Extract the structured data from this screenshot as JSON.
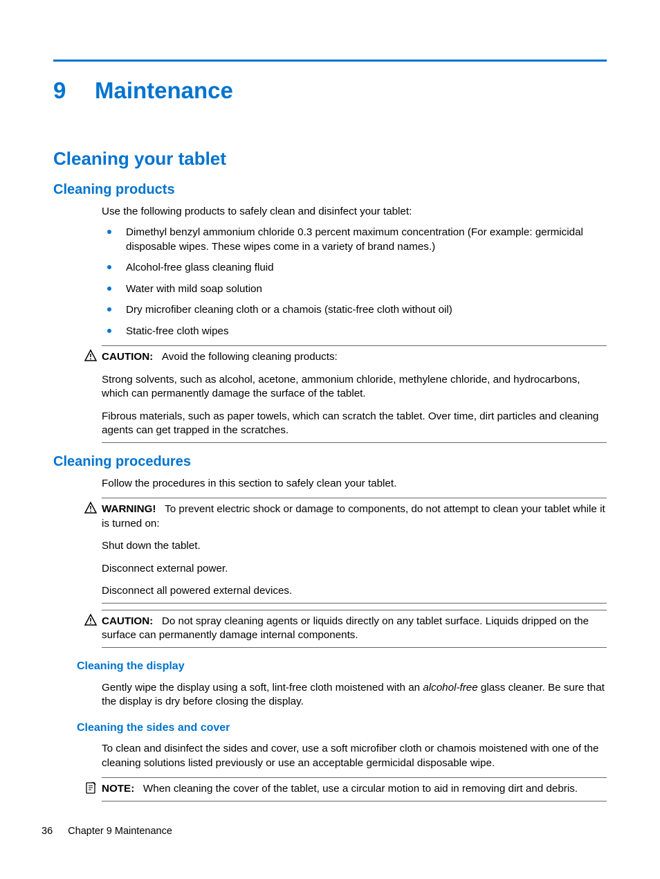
{
  "chapter": {
    "number": "9",
    "title": "Maintenance"
  },
  "section": {
    "title": "Cleaning your tablet"
  },
  "products": {
    "heading": "Cleaning products",
    "intro": "Use the following products to safely clean and disinfect your tablet:",
    "items": [
      "Dimethyl benzyl ammonium chloride 0.3 percent maximum concentration (For example: germicidal disposable wipes. These wipes come in a variety of brand names.)",
      "Alcohol-free glass cleaning fluid",
      "Water with mild soap solution",
      "Dry microfiber cleaning cloth or a chamois (static-free cloth without oil)",
      "Static-free cloth wipes"
    ],
    "caution_label": "CAUTION:",
    "caution_lead": "Avoid the following cleaning products:",
    "caution_p1": "Strong solvents, such as alcohol, acetone, ammonium chloride, methylene chloride, and hydrocarbons, which can permanently damage the surface of the tablet.",
    "caution_p2": "Fibrous materials, such as paper towels, which can scratch the tablet. Over time, dirt particles and cleaning agents can get trapped in the scratches."
  },
  "procedures": {
    "heading": "Cleaning procedures",
    "intro": "Follow the procedures in this section to safely clean your tablet.",
    "warning_label": "WARNING!",
    "warning_lead": "To prevent electric shock or damage to components, do not attempt to clean your tablet while it is turned on:",
    "warning_p1": "Shut down the tablet.",
    "warning_p2": "Disconnect external power.",
    "warning_p3": "Disconnect all powered external devices.",
    "caution_label": "CAUTION:",
    "caution_text": "Do not spray cleaning agents or liquids directly on any tablet surface. Liquids dripped on the surface can permanently damage internal components."
  },
  "display_section": {
    "heading": "Cleaning the display",
    "text_pre": "Gently wipe the display using a soft, lint-free cloth moistened with an ",
    "text_em": "alcohol-free",
    "text_post": " glass cleaner. Be sure that the display is dry before closing the display."
  },
  "sides_section": {
    "heading": "Cleaning the sides and cover",
    "text": "To clean and disinfect the sides and cover, use a soft microfiber cloth or chamois moistened with one of the cleaning solutions listed previously or use an acceptable germicidal disposable wipe.",
    "note_label": "NOTE:",
    "note_text": "When cleaning the cover of the tablet, use a circular motion to aid in removing dirt and debris."
  },
  "footer": {
    "page": "36",
    "chapter_ref": "Chapter 9   Maintenance"
  }
}
